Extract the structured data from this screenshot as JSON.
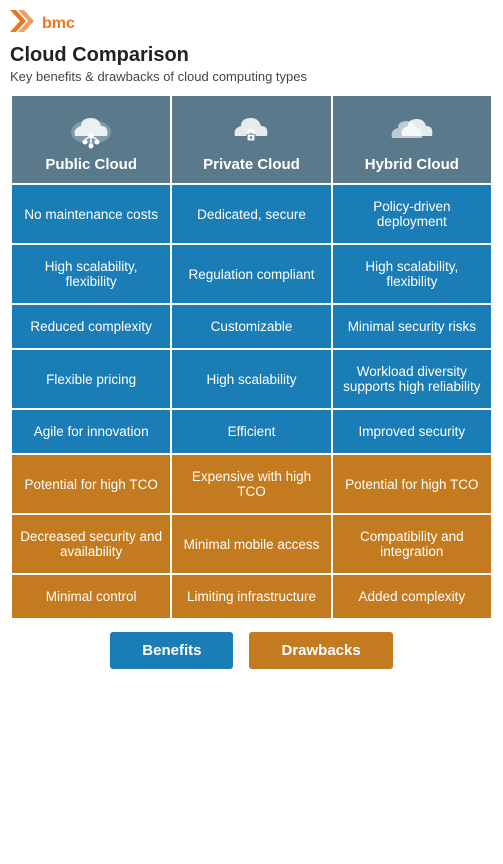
{
  "logo": {
    "symbol": "›",
    "text": "bmc"
  },
  "title": "Cloud Comparison",
  "subtitle": "Key benefits & drawbacks of cloud computing types",
  "headers": [
    {
      "label": "Public Cloud"
    },
    {
      "label": "Private Cloud"
    },
    {
      "label": "Hybrid Cloud"
    }
  ],
  "rows": [
    {
      "type": "benefit",
      "cells": [
        "No maintenance costs",
        "Dedicated, secure",
        "Policy-driven deployment"
      ]
    },
    {
      "type": "benefit",
      "cells": [
        "High scalability, flexibility",
        "Regulation compliant",
        "High scalability, flexibility"
      ]
    },
    {
      "type": "benefit",
      "cells": [
        "Reduced complexity",
        "Customizable",
        "Minimal security risks"
      ]
    },
    {
      "type": "benefit",
      "cells": [
        "Flexible pricing",
        "High scalability",
        "Workload diversity supports high reliability"
      ]
    },
    {
      "type": "benefit",
      "cells": [
        "Agile for innovation",
        "Efficient",
        "Improved security"
      ]
    },
    {
      "type": "drawback",
      "cells": [
        "Potential for high TCO",
        "Expensive with high TCO",
        "Potential for high TCO"
      ]
    },
    {
      "type": "drawback",
      "cells": [
        "Decreased security and availability",
        "Minimal mobile access",
        "Compatibility and integration"
      ]
    },
    {
      "type": "drawback",
      "cells": [
        "Minimal control",
        "Limiting infrastructure",
        "Added complexity"
      ]
    }
  ],
  "legend": {
    "benefit_label": "Benefits",
    "drawback_label": "Drawbacks"
  }
}
